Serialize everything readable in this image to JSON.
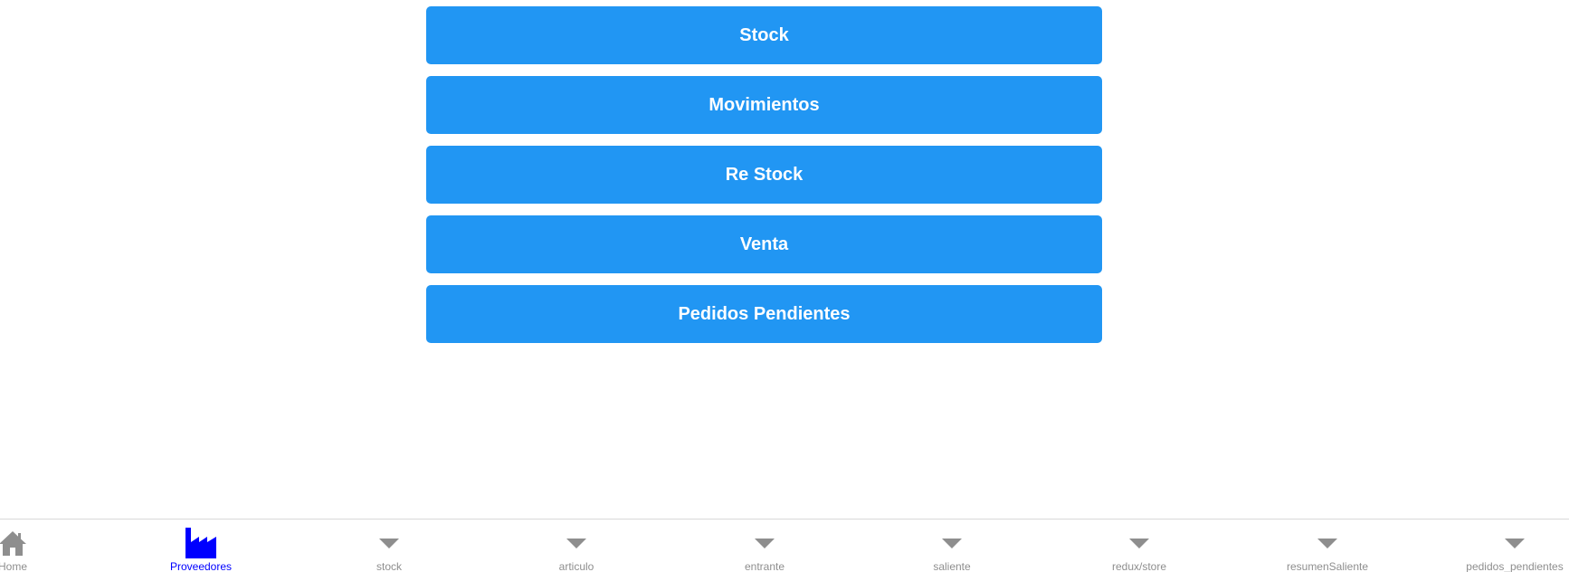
{
  "menu": {
    "buttons": [
      {
        "label": "Stock"
      },
      {
        "label": "Movimientos"
      },
      {
        "label": "Re Stock"
      },
      {
        "label": "Venta"
      },
      {
        "label": "Pedidos Pendientes"
      }
    ]
  },
  "tabbar": {
    "active_color": "#0000ff",
    "inactive_color": "#8e8e8e",
    "tabs": [
      {
        "label": "Home",
        "icon": "home-icon"
      },
      {
        "label": "Proveedores",
        "icon": "factory-icon",
        "active": true
      },
      {
        "label": "stock",
        "icon": "caret-down-icon"
      },
      {
        "label": "articulo",
        "icon": "caret-down-icon"
      },
      {
        "label": "entrante",
        "icon": "caret-down-icon"
      },
      {
        "label": "saliente",
        "icon": "caret-down-icon"
      },
      {
        "label": "redux/store",
        "icon": "caret-down-icon"
      },
      {
        "label": "resumenSaliente",
        "icon": "caret-down-icon"
      },
      {
        "label": "pedidos_pendientes",
        "icon": "caret-down-icon"
      }
    ]
  }
}
